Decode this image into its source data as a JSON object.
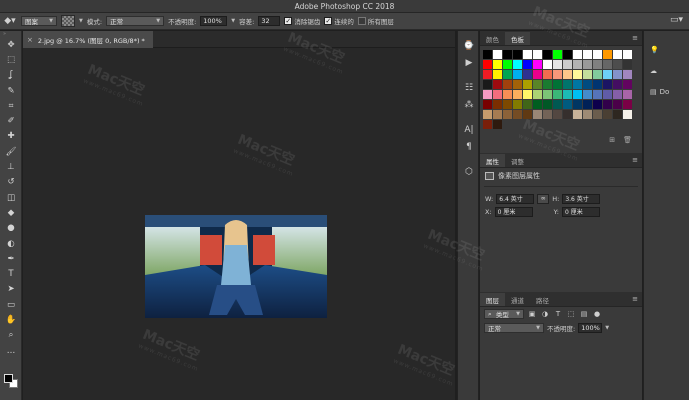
{
  "window": {
    "title": "Adobe Photoshop CC 2018"
  },
  "options_bar": {
    "fill_source": "图案",
    "mode_label": "模式:",
    "mode_value": "正常",
    "opacity_label": "不透明度:",
    "opacity_value": "100%",
    "tolerance_label": "容差:",
    "tolerance_value": "32",
    "antialias_label": "消除锯齿",
    "contiguous_label": "连续的",
    "all_layers_label": "所有图层"
  },
  "document": {
    "tab_label": "2.jpg @ 16.7% (图层 0, RGB/8*) *",
    "close": "×"
  },
  "tools": [
    "move-icon",
    "marquee-icon",
    "lasso-icon",
    "quick-select-icon",
    "crop-icon",
    "eyedropper-icon",
    "healing-brush-icon",
    "brush-icon",
    "clone-stamp-icon",
    "history-brush-icon",
    "eraser-icon",
    "paint-bucket-icon",
    "blur-icon",
    "dodge-icon",
    "pen-icon",
    "type-icon",
    "path-select-icon",
    "rectangle-icon",
    "hand-icon",
    "zoom-icon",
    "more-tools-icon"
  ],
  "tool_glyphs": [
    "✥",
    "⬚",
    "ʆ",
    "✎",
    "⌗",
    "✐",
    "✚",
    "🖌",
    "⊥",
    "↺",
    "◫",
    "◆",
    "●",
    "◐",
    "✒",
    "T",
    "➤",
    "▭",
    "✋",
    "⌕",
    "…"
  ],
  "swatches_panel": {
    "tabs": [
      "颜色",
      "色板"
    ],
    "colors": [
      "#000000",
      "#ffffff",
      "#000000",
      "#000000",
      "#ffffff",
      "#ffffff",
      "#000000",
      "#00ff00",
      "#000000",
      "#ffffff",
      "#ffffff",
      "#ffffff",
      "#ff9900",
      "#ffffff",
      "#ffffff",
      "#ff0000",
      "#ffff00",
      "#00ff00",
      "#00ffff",
      "#0000ff",
      "#ff00ff",
      "#ffffff",
      "#e6e6e6",
      "#cccccc",
      "#b3b3b3",
      "#999999",
      "#808080",
      "#666666",
      "#4d4d4d",
      "#333333",
      "#ee1c24",
      "#fff200",
      "#00a651",
      "#00aeef",
      "#2e3192",
      "#ec008c",
      "#f26c4f",
      "#f7977a",
      "#fdc68a",
      "#fff79a",
      "#c4df9b",
      "#82ca9c",
      "#6dcff6",
      "#8493ca",
      "#a186be",
      "#1a1a1a",
      "#9e0b0f",
      "#a0410d",
      "#a36209",
      "#aba000",
      "#598527",
      "#1a7b30",
      "#007236",
      "#00746b",
      "#0076a3",
      "#004b80",
      "#003471",
      "#1b1464",
      "#440e62",
      "#630460",
      "#f49ac2",
      "#f26d7d",
      "#f68e56",
      "#fbaf5d",
      "#fff568",
      "#acd373",
      "#7cc576",
      "#3bb878",
      "#1cbbb4",
      "#00bff3",
      "#448ccb",
      "#5674b9",
      "#605ca8",
      "#855fa8",
      "#a864a8",
      "#790000",
      "#7b2e00",
      "#7d4900",
      "#827b00",
      "#406618",
      "#005e20",
      "#005826",
      "#005952",
      "#005b7f",
      "#003663",
      "#002157",
      "#0d004c",
      "#32004b",
      "#4b0049",
      "#7b0046",
      "#c69c6d",
      "#a67c52",
      "#8c6239",
      "#754c24",
      "#603913",
      "#998675",
      "#736357",
      "#534741",
      "#362f2d",
      "#c7b299",
      "#9e8b75",
      "#6b5d4d",
      "#4a3f33",
      "#2e2720",
      "#f5f0e8",
      "#7a1f0a",
      "#2e1a0e"
    ]
  },
  "properties_panel": {
    "tabs": [
      "属性",
      "调整"
    ],
    "title": "像素图层属性",
    "w_label": "W:",
    "w_value": "6.4 英寸",
    "h_label": "H:",
    "h_value": "3.6 英寸",
    "x_label": "X:",
    "x_value": "0 厘米",
    "y_label": "Y:",
    "y_value": "0 厘米"
  },
  "layers_panel": {
    "tabs": [
      "图层",
      "通道",
      "路径"
    ],
    "filter_kind": "类型",
    "blend_mode": "正常",
    "opacity_label": "不透明度:",
    "opacity_value": "100%"
  },
  "right_column": {
    "libraries_label": "Do"
  },
  "watermark": {
    "brand": "Mac天空",
    "url": "www.mac69.com"
  },
  "colors": {
    "chrome": "#434343",
    "canvas": "#282828",
    "panel": "#3a3a3a"
  }
}
